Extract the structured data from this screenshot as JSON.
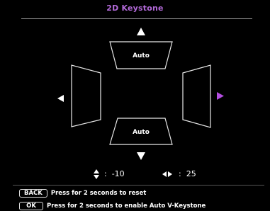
{
  "menu": {
    "title": "2D Keystone"
  },
  "keystone": {
    "top_label": "Auto",
    "bottom_label": "Auto",
    "vertical_value": "-10",
    "horizontal_value": "25",
    "separator": ":",
    "active_arrow": "right"
  },
  "icons": {
    "up_arrow": "up-arrow-icon",
    "down_arrow": "down-arrow-icon",
    "left_arrow": "left-arrow-icon",
    "right_arrow": "right-arrow-icon",
    "vertical": "up-down-arrows-icon",
    "horizontal": "left-right-arrows-icon"
  },
  "help": [
    {
      "key": "BACK",
      "text": "Press for 2 seconds to reset"
    },
    {
      "key": "OK",
      "text": "Press for 2 seconds to enable Auto V-Keystone"
    }
  ],
  "colors": {
    "background": "#000000",
    "title": "#b36ad9",
    "active_arrow": "#b34de0",
    "text": "#ffffff"
  }
}
